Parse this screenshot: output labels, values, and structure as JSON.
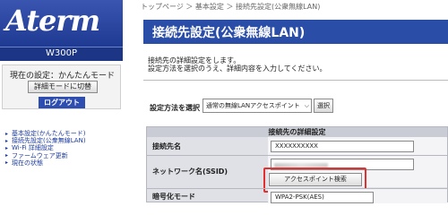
{
  "sidebar": {
    "logo": "Aterm",
    "model": "W300P",
    "mode_text": "現在の設定：かんたんモード",
    "mode_button": "詳細モードに切替",
    "logout_button": "ログアウト",
    "nav": [
      {
        "label": "基本設定(かんたんモード)"
      },
      {
        "label": "接続先設定(公衆無線LAN)"
      },
      {
        "label": "Wi-Fi 詳細設定"
      },
      {
        "label": "ファームウェア更新"
      },
      {
        "label": "現在の状態"
      }
    ]
  },
  "breadcrumb": "トップページ ＞ 基本設定 ＞ 接続先設定(公衆無線LAN)",
  "title": "接続先設定(公衆無線LAN)",
  "description": {
    "line1": "接続先の詳細設定をします。",
    "line2": "設定方法を選択のうえ、詳細内容を入力してください。"
  },
  "method": {
    "label": "設定方法を選択",
    "selected": "通常の無線LANアクセスポイント",
    "select_button": "選択"
  },
  "table": {
    "header": "接続先の詳細設定",
    "rows": {
      "name_label": "接続先名",
      "name_value": "XXXXXXXXXX",
      "ssid_label": "ネットワーク名(SSID)",
      "ap_search_button": "アクセスポイント検索",
      "encryption_label": "暗号化モード",
      "encryption_value": "WPA2-PSK(AES)"
    }
  },
  "colors": {
    "header_blue": "#2a4da8",
    "highlight": "#e03030",
    "link": "#1b3a9c"
  }
}
